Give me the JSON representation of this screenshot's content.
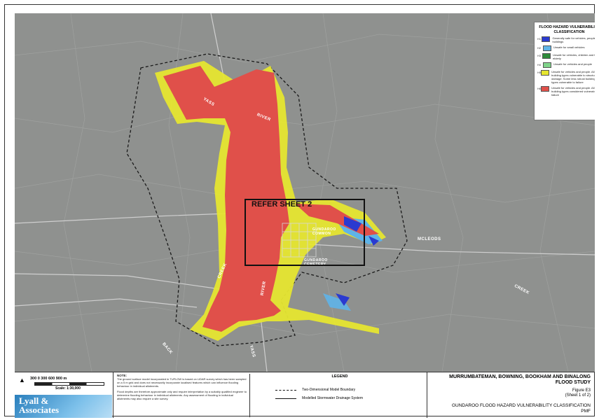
{
  "map": {
    "refer_label": "REFER SHEET 2",
    "labels": {
      "yass_river_1": "YASS",
      "yass_river_2": "RIVER",
      "yass_river_3": "RIVER",
      "yass_river_4": "YASS",
      "creek_1": "CREEK",
      "back": "BACK",
      "mcleods": "MCLEODS",
      "creek_2": "CREEK",
      "gundaroo_common": "GUNDAROO COMMON",
      "gundaroo_cemetery": "GUNDAROO CEMETERY"
    }
  },
  "legend": {
    "title": "FLOOD HAZARD VULNERABILITY CLASSIFICATION",
    "items": [
      {
        "code": "H1",
        "color": "#2a3ad0",
        "desc": "Generally safe for vehicles, people and buildings"
      },
      {
        "code": "H2",
        "color": "#5fb4e8",
        "desc": "Unsafe for small vehicles"
      },
      {
        "code": "H3",
        "color": "#2e8b3a",
        "desc": "Unsafe for vehicles, children and the elderly"
      },
      {
        "code": "H4",
        "color": "#7fd38a",
        "desc": "Unsafe for vehicles and people"
      },
      {
        "code": "H5",
        "color": "#e6e630",
        "desc": "Unsafe for vehicles and people. All building types vulnerable to structural damage. Some less robust building types vulnerable to failure"
      },
      {
        "code": "H6",
        "color": "#e0504a",
        "desc": "Unsafe for vehicles and people. All building types considered vulnerable to failure"
      }
    ]
  },
  "footer": {
    "scale_numbers": "300   0   300   600   900 m",
    "scale_text": "Scale: 1:30,000",
    "north": "N",
    "logo_line1": "Lyall &",
    "logo_line2": "Associates",
    "notes_head": "NOTE:",
    "note1": "The ground surface model incorporated in TUFLOW is based on LiDAR survey which has been sampled on a 5 m grid and does not necessarily incorporate localised features which can influence flooding behaviour in individual allotments.",
    "note2": "Flood depths are therefore approximate only and require interpretation by a suitably qualified engineer to determine flooding behaviour in individual allotments. Any assessment of flooding in individual allotments may also require a site survey.",
    "legend_title": "LEGEND",
    "legend_items": [
      "Two-Dimensional Model Boundary",
      "Modelled Stormwater Drainage System"
    ],
    "title_line1": "MURRUMBATEMAN, BOWNING, BOOKHAM AND BINALONG",
    "title_line2": "FLOOD STUDY",
    "figure": "Figure E3",
    "sheet": "(Sheet 1 of 2)",
    "subtitle": "GUNDAROO FLOOD HAZARD VULNERABILITY CLASSIFICATION",
    "event": "PMF"
  },
  "colors": {
    "red": "#e0504a",
    "yellow": "#e6e630",
    "blue": "#2a3ad0",
    "map_bg": "#8f918f"
  }
}
